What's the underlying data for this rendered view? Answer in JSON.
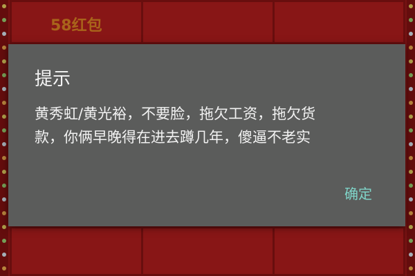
{
  "background": {
    "red_packet_label": "58红包",
    "board_color": "#921818",
    "label_color": "#cf7b22"
  },
  "dialog": {
    "title": "提示",
    "message_lines": [
      "黄秀虹/黄光裕，不要脸，拖欠工资，拖欠货",
      "款，你俩早晚得在进去蹲几年，傻逼不老实"
    ],
    "confirm_label": "确定",
    "background_color": "#5b5c5b",
    "accent_color": "#7fd4c8"
  }
}
